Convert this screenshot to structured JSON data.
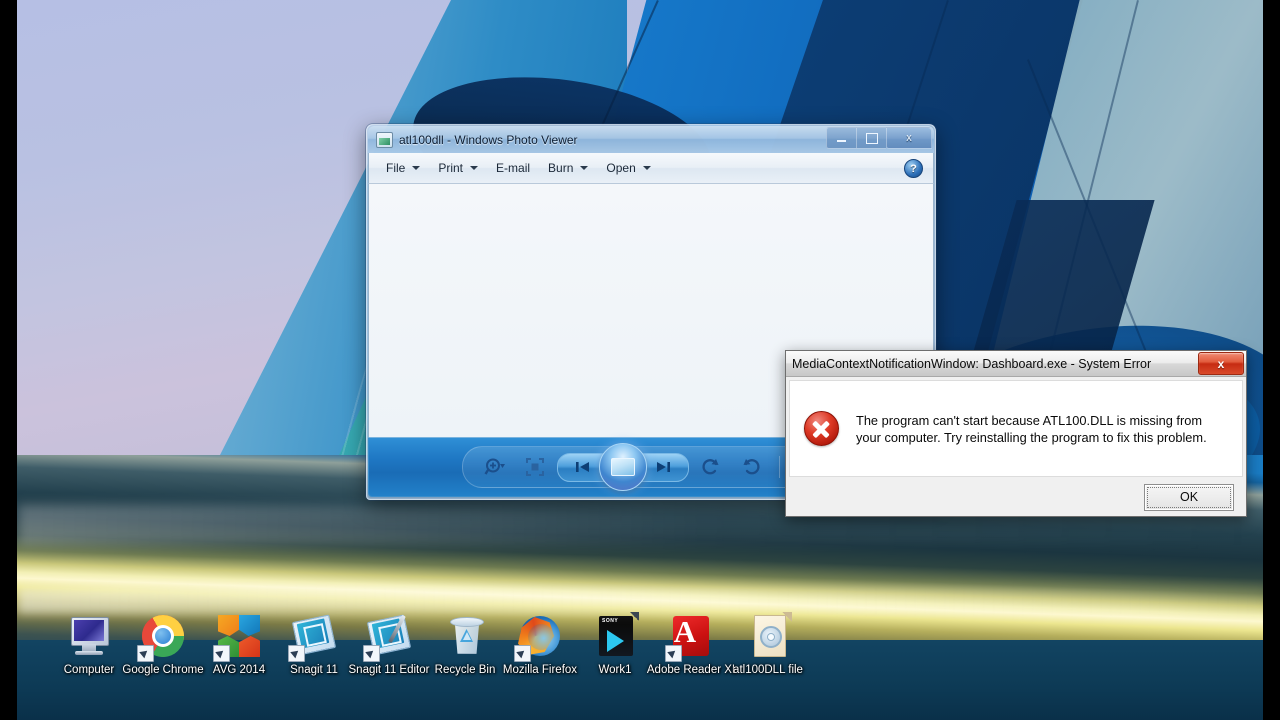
{
  "desktop": {
    "icons": [
      {
        "label": "Computer",
        "icon": "computer-icon"
      },
      {
        "label": "Google Chrome",
        "icon": "chrome-icon"
      },
      {
        "label": "AVG 2014",
        "icon": "avg-icon"
      },
      {
        "label": "Snagit 11",
        "icon": "snagit-icon"
      },
      {
        "label": "Snagit 11 Editor",
        "icon": "snagit-editor-icon"
      },
      {
        "label": "Recycle Bin",
        "icon": "recycle-bin-icon"
      },
      {
        "label": "Mozilla Firefox",
        "icon": "firefox-icon"
      },
      {
        "label": "Work1",
        "icon": "video-file-icon"
      },
      {
        "label": "Adobe Reader XI",
        "icon": "adobe-reader-icon"
      },
      {
        "label": "atl100DLL file",
        "icon": "dll-file-icon"
      }
    ]
  },
  "photo_viewer": {
    "title": "atl100dll - Windows Photo Viewer",
    "title_icon": "photo-viewer-icon",
    "window_buttons": {
      "minimize": "minimize-button",
      "maximize": "maximize-button",
      "close_label": "x"
    },
    "menu": [
      {
        "label": "File",
        "has_caret": true
      },
      {
        "label": "Print",
        "has_caret": true
      },
      {
        "label": "E-mail",
        "has_caret": false
      },
      {
        "label": "Burn",
        "has_caret": true
      },
      {
        "label": "Open",
        "has_caret": true
      }
    ],
    "help_label": "?",
    "toolbar": [
      {
        "name": "zoom-button",
        "glyph": "zoom-icon"
      },
      {
        "name": "actual-size-button",
        "glyph": "fit-to-window-icon"
      },
      {
        "name": "previous-button",
        "glyph": "previous-icon"
      },
      {
        "name": "play-slideshow-button",
        "glyph": "slideshow-icon"
      },
      {
        "name": "next-button",
        "glyph": "next-icon"
      },
      {
        "name": "rotate-counterclockwise-button",
        "glyph": "rotate-ccw-icon"
      },
      {
        "name": "rotate-clockwise-button",
        "glyph": "rotate-cw-icon"
      },
      {
        "name": "delete-button",
        "glyph": "delete-icon"
      }
    ]
  },
  "error_dialog": {
    "title": "MediaContextNotificationWindow: Dashboard.exe - System Error",
    "close_label": "x",
    "icon": "error-icon",
    "message": "The program can't start because ATL100.DLL is missing from your computer. Try reinstalling the program to fix this problem.",
    "ok_label": "OK"
  },
  "colors": {
    "error_red": "#c62b12",
    "aero_blue": "#1f78c4",
    "dialog_gray": "#f0f0f0",
    "letterbox": "#000000"
  }
}
